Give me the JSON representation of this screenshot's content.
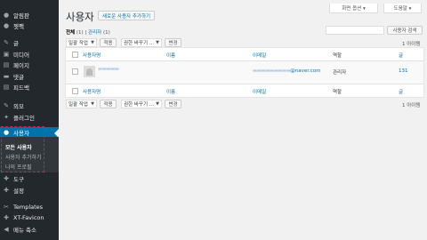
{
  "sidebar": {
    "items": [
      {
        "icon": "bell-icon",
        "glyph": "●",
        "label": "알림판"
      },
      {
        "icon": "jetpack-icon",
        "glyph": "●",
        "label": "젯팩"
      },
      {
        "icon": "pin-icon",
        "glyph": "✎",
        "label": "글"
      },
      {
        "icon": "media-icon",
        "glyph": "▣",
        "label": "미디어"
      },
      {
        "icon": "page-icon",
        "glyph": "▤",
        "label": "페이지"
      },
      {
        "icon": "comment-icon",
        "glyph": "▬",
        "label": "댓글"
      },
      {
        "icon": "feedback-icon",
        "glyph": "▤",
        "label": "피드백"
      },
      {
        "icon": "brush-icon",
        "glyph": "✎",
        "label": "외모"
      },
      {
        "icon": "plugin-icon",
        "glyph": "✦",
        "label": "플러그인"
      },
      {
        "icon": "users-icon",
        "glyph": "●",
        "label": "사용자"
      },
      {
        "icon": "wrench-icon",
        "glyph": "✚",
        "label": "도구"
      },
      {
        "icon": "settings-icon",
        "glyph": "✚",
        "label": "설정"
      },
      {
        "icon": "templates-icon",
        "glyph": "✂",
        "label": "Templates"
      },
      {
        "icon": "favicon-icon",
        "glyph": "✚",
        "label": "XT-Favicon"
      },
      {
        "icon": "collapse-icon",
        "glyph": "◀",
        "label": "메뉴 축소"
      }
    ],
    "submenu": [
      "모든 사용자",
      "사용자 추가하기",
      "나의 프로필"
    ]
  },
  "tabs": {
    "screen_options": "화면 옵션 ▾",
    "help": "도움말 ▾"
  },
  "page": {
    "title": "사용자",
    "add_new": "새로운 사용자 추가하기"
  },
  "filters": {
    "all": "전체",
    "all_count": "(1)",
    "sep": "|",
    "admin": "관리자",
    "admin_count": "(1)"
  },
  "search": {
    "button": "사용자 검색"
  },
  "bulk": {
    "label": "일괄 작업",
    "apply": "적용",
    "role_label": "권한 바꾸기 ...",
    "change": "변경"
  },
  "count_text": "1 아이템",
  "table": {
    "headers": [
      "사용자명",
      "이름",
      "이메일",
      "역할",
      "글"
    ],
    "row": {
      "username": "▬▬▬▬▬",
      "name": "",
      "email_masked": "▬▬▬▬▬▬▬▬▬",
      "email_domain": "@naver.com",
      "role": "관리자",
      "posts": "131"
    }
  },
  "colors": {
    "sidebar_bg": "#23282d",
    "accent": "#0073aa",
    "highlight": "#e0185c"
  }
}
